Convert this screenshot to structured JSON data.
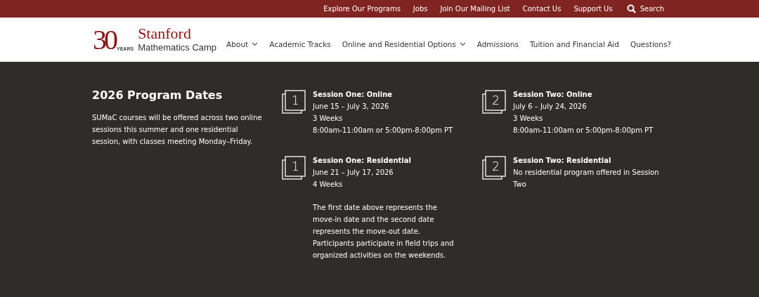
{
  "utility_bar": {
    "links": [
      "Explore Our Programs",
      "Jobs",
      "Join Our Mailing List",
      "Contact Us",
      "Support Us"
    ],
    "search": "Search"
  },
  "header": {
    "logo": {
      "number": "30",
      "years": "YEARS",
      "name": "Stanford",
      "subtitle": "Mathematics Camp"
    },
    "nav": [
      {
        "label": "About",
        "has_menu": true
      },
      {
        "label": "Academic Tracks",
        "has_menu": false
      },
      {
        "label": "Online and Residential Options",
        "has_menu": true
      },
      {
        "label": "Admissions",
        "has_menu": false
      },
      {
        "label": "Tuition and Financial Aid",
        "has_menu": false
      },
      {
        "label": "Questions?",
        "has_menu": false
      }
    ]
  },
  "intro": {
    "title": "2026 Program Dates",
    "text": "SUMaC courses will be offered across two online sessions this summer and one residential session, with classes meeting Monday–Friday."
  },
  "sessions": [
    {
      "number": "1",
      "title": "Session One: Online",
      "lines": [
        "June 15 – July 3, 2026",
        "3 Weeks",
        "8:00am-11:00am or 5:00pm-8:00pm PT"
      ]
    },
    {
      "number": "2",
      "title": "Session Two: Online",
      "lines": [
        "July 6 – July 24, 2026",
        "3 Weeks",
        "8:00am-11:00am or 5:00pm-8:00pm PT"
      ]
    },
    {
      "number": "1",
      "title": "Session One: Residential",
      "lines": [
        "June 21 – July 17, 2026",
        "4 Weeks"
      ],
      "note": "The first date above represents the move-in date and the second date represents the move-out date. Participants participate in field trips and organized activities on the weekends."
    },
    {
      "number": "2",
      "title": "Session Two: Residential",
      "lines": [
        "No residential program offered in Session Two"
      ]
    }
  ]
}
